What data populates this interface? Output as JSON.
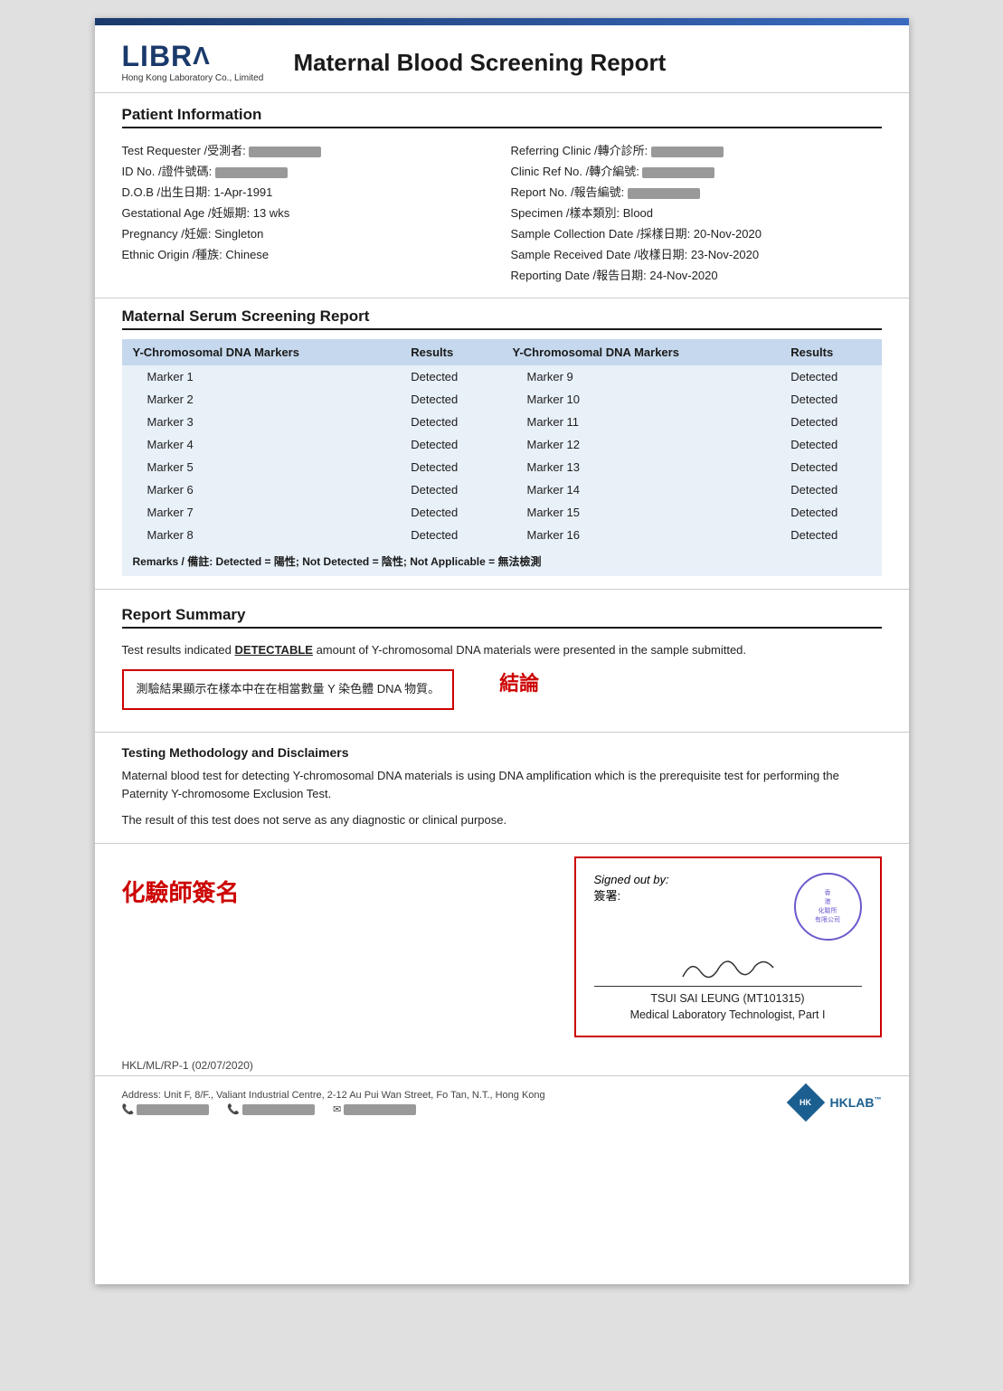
{
  "header": {
    "logo_main": "LIBRA",
    "logo_sub": "Hong Kong Laboratory Co., Limited",
    "report_title": "Maternal Blood Screening Report"
  },
  "patient_info": {
    "section_title": "Patient Information",
    "left": [
      {
        "label": "Test Requester /受測者:",
        "value": "REDACTED"
      },
      {
        "label": "ID No. /證件號碼:",
        "value": "REDACTED"
      },
      {
        "label": "D.O.B /出生日期:",
        "value": "1-Apr-1991"
      },
      {
        "label": "Gestational Age /妊娠期:",
        "value": "13 wks"
      },
      {
        "label": "Pregnancy /妊娠:",
        "value": "Singleton"
      },
      {
        "label": "Ethnic Origin /種族:",
        "value": "Chinese"
      }
    ],
    "right": [
      {
        "label": "Referring Clinic /轉介診所:",
        "value": "REDACTED"
      },
      {
        "label": "Clinic Ref No. /轉介編號:",
        "value": "REDACTED"
      },
      {
        "label": "Report No. /報告編號:",
        "value": "REDACTED"
      },
      {
        "label": "Specimen /樣本類別:",
        "value": "Blood"
      },
      {
        "label": "Sample Collection Date /採樣日期:",
        "value": "20-Nov-2020"
      },
      {
        "label": "Sample Received Date /收樣日期:",
        "value": "23-Nov-2020"
      },
      {
        "label": "Reporting Date /報告日期:",
        "value": "24-Nov-2020"
      }
    ]
  },
  "screening": {
    "section_title": "Maternal Serum Screening Report",
    "col1_header": "Y-Chromosomal DNA Markers",
    "col2_header": "Results",
    "col3_header": "Y-Chromosomal DNA Markers",
    "col4_header": "Results",
    "markers_left": [
      {
        "marker": "Marker 1",
        "result": "Detected"
      },
      {
        "marker": "Marker 2",
        "result": "Detected"
      },
      {
        "marker": "Marker 3",
        "result": "Detected"
      },
      {
        "marker": "Marker 4",
        "result": "Detected"
      },
      {
        "marker": "Marker 5",
        "result": "Detected"
      },
      {
        "marker": "Marker 6",
        "result": "Detected"
      },
      {
        "marker": "Marker 7",
        "result": "Detected"
      },
      {
        "marker": "Marker 8",
        "result": "Detected"
      }
    ],
    "markers_right": [
      {
        "marker": "Marker 9",
        "result": "Detected"
      },
      {
        "marker": "Marker 10",
        "result": "Detected"
      },
      {
        "marker": "Marker 11",
        "result": "Detected"
      },
      {
        "marker": "Marker 12",
        "result": "Detected"
      },
      {
        "marker": "Marker 13",
        "result": "Detected"
      },
      {
        "marker": "Marker 14",
        "result": "Detected"
      },
      {
        "marker": "Marker 15",
        "result": "Detected"
      },
      {
        "marker": "Marker 16",
        "result": "Detected"
      }
    ],
    "remarks": "Remarks / 備註: Detected = 陽性; Not Detected = 陰性; Not Applicable = 無法檢測"
  },
  "report_summary": {
    "section_title": "Report Summary",
    "summary_text_1": "Test results indicated ",
    "summary_detectable": "DETECTABLE",
    "summary_text_2": " amount of Y-chromosomal DNA materials were presented in the sample submitted.",
    "conclusion_chinese": "測驗結果顯示在樣本中在在相當數量 Y 染色體 DNA 物質。",
    "conclusion_label": "結論"
  },
  "methodology": {
    "title": "Testing Methodology and Disclaimers",
    "text1": "Maternal blood test for detecting Y-chromosomal DNA materials is using DNA amplification which is the prerequisite test for performing the Paternity Y-chromosome Exclusion Test.",
    "text2": "The result of this test does not serve as any diagnostic or clinical purpose."
  },
  "signoff": {
    "chemist_label": "化驗師簽名",
    "signed_out_by": "Signed out by:",
    "signed_by_chinese": "簽署:",
    "signer_name": "TSUI SAI LEUNG (MT101315)",
    "signer_title": "Medical Laboratory Technologist, Part I",
    "stamp_text": "香港化驗所有限公司"
  },
  "footer": {
    "ref": "HKL/ML/RP-1 (02/07/2020)",
    "address": "Address: Unit F, 8/F., Valiant Industrial Centre, 2-12 Au Pui Wan Street, Fo Tan, N.T., Hong Kong",
    "hklab": "HKLAB"
  }
}
